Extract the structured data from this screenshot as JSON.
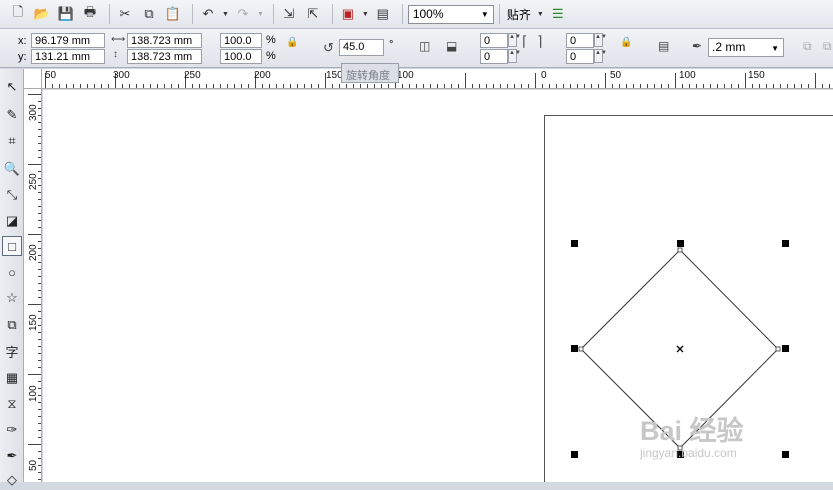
{
  "toolbar": {
    "zoom": "100%",
    "snap": "贴齐",
    "icons": [
      "new-file-icon",
      "open-folder-icon",
      "save-icon",
      "print-icon",
      "cut-icon",
      "copy-icon",
      "paste-icon",
      "undo-icon",
      "redo-icon",
      "import-icon",
      "export-icon",
      "publish-pdf-icon",
      "app-launcher-icon",
      "align-options-icon"
    ]
  },
  "property_bar": {
    "x_label": "x:",
    "y_label": "y:",
    "x_value": "96.179 mm",
    "y_value": "131.21 mm",
    "width_value": "138.723 mm",
    "height_value": "138.723 mm",
    "scale_x": "100.0",
    "scale_y": "100.0",
    "percent": "%",
    "rotation": "45.0",
    "degree": "°",
    "corner_tl": "0",
    "corner_bl": "0",
    "corner_tr": "0",
    "corner_br": "0",
    "outline_width": ".2 mm"
  },
  "tooltip": "旋转角度",
  "rulers": {
    "horizontal": [
      "50",
      "300",
      "250",
      "200",
      "150",
      "100",
      "0",
      "50",
      "100",
      "150"
    ],
    "vertical": [
      "300",
      "250",
      "200",
      "150",
      "100",
      "50"
    ]
  },
  "tools": [
    "pick-tool-icon",
    "shape-tool-icon",
    "crop-tool-icon",
    "zoom-tool-icon",
    "freehand-tool-icon",
    "smart-fill-icon",
    "rectangle-tool-icon",
    "ellipse-tool-icon",
    "polygon-tool-icon",
    "basic-shapes-icon",
    "text-tool-icon",
    "table-tool-icon",
    "interactive-tool-icon",
    "eyedropper-tool-icon",
    "outline-tool-icon",
    "fill-tool-icon"
  ],
  "watermark": {
    "line1": "Bai 经验",
    "line2": "jingyan.baidu.com"
  }
}
